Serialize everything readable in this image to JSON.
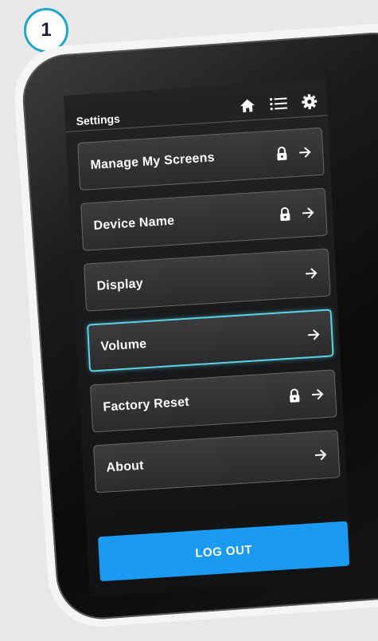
{
  "step": {
    "number": "1"
  },
  "header": {
    "title": "Settings",
    "icons": [
      "home-icon",
      "list-icon",
      "gear-icon"
    ]
  },
  "menu": {
    "items": [
      {
        "label": "Manage My Screens",
        "locked": true,
        "selected": false
      },
      {
        "label": "Device Name",
        "locked": true,
        "selected": false
      },
      {
        "label": "Display",
        "locked": false,
        "selected": false
      },
      {
        "label": "Volume",
        "locked": false,
        "selected": true
      },
      {
        "label": "Factory Reset",
        "locked": true,
        "selected": false
      },
      {
        "label": "About",
        "locked": false,
        "selected": false
      }
    ]
  },
  "logout": {
    "label": "LOG OUT"
  },
  "colors": {
    "accent": "#1a9af0",
    "selected_outline": "#5fd3e3",
    "badge_outline": "#22a7c2"
  }
}
